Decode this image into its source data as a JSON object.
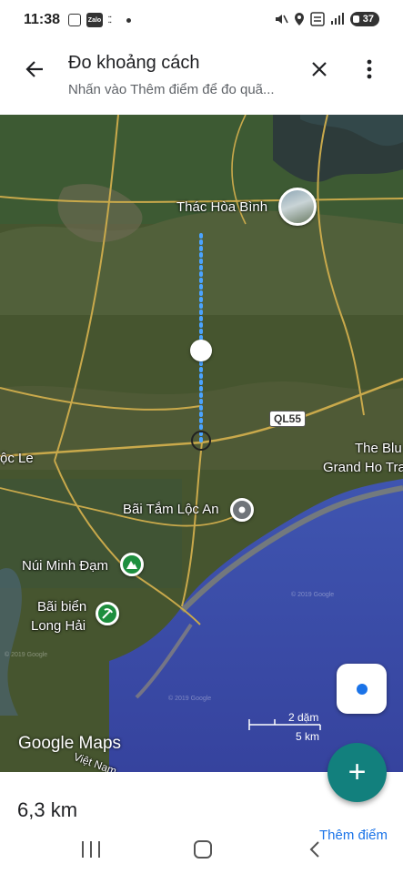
{
  "status_bar": {
    "time": "11:38",
    "zalo": "Zalo",
    "battery": "37"
  },
  "header": {
    "title": "Đo khoảng cách",
    "subtitle": "Nhấn vào Thêm điểm để đo quã..."
  },
  "map": {
    "labels": {
      "thac_hoa_binh": "Thác Hòa Bình",
      "road_ql55": "QL55",
      "the_blu": "The Blu",
      "grand_ho_tra": "Grand Ho Tra",
      "loc_le": "ộc Le",
      "bai_tam_loc_an": "Bãi Tắm Lộc An",
      "nui_minh_dam": "Núi Minh Đạm",
      "bai_bien_line1": "Bãi biển",
      "bai_bien_line2": "Long Hải",
      "viet_nam": "Việt Nam"
    },
    "scale": {
      "imperial": "2 dặm",
      "metric": "5 km"
    },
    "logo": "Google Maps",
    "watermark": "© 2019 Google"
  },
  "sheet": {
    "distance": "6,3 km",
    "add_point": "Thêm điểm",
    "fab_symbol": "+"
  },
  "colors": {
    "accent": "#1a73e8",
    "fab": "#12807d",
    "sea": "#3b4aa6",
    "land": "#46552f"
  }
}
